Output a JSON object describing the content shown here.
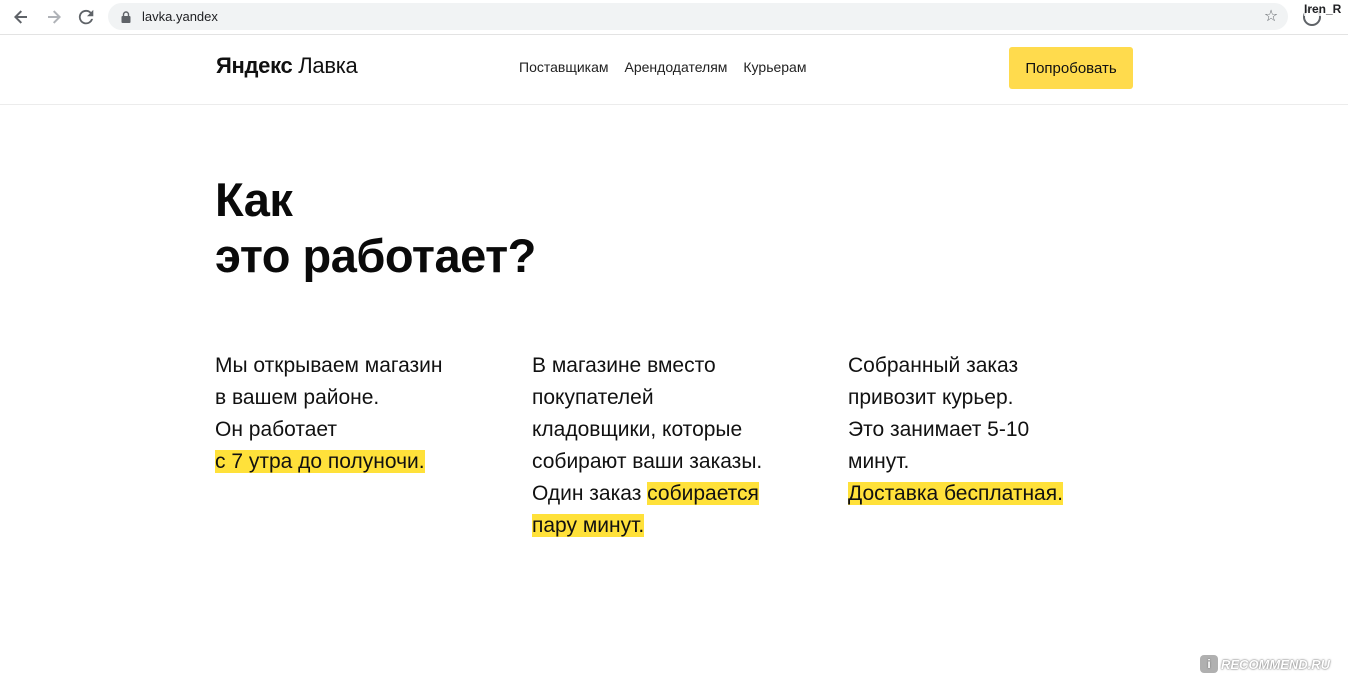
{
  "browser": {
    "url": "lavka.yandex",
    "profile_name": "Iren_R"
  },
  "header": {
    "logo_brand": "Яндекс",
    "logo_product": "Лавка",
    "nav": [
      "Поставщикам",
      "Арендодателям",
      "Курьерам"
    ],
    "cta_label": "Попробовать",
    "cta_color": "#ffdb4d"
  },
  "hero": {
    "title_line1": "Как",
    "title_line2": "это работает?"
  },
  "steps": [
    {
      "lines": [
        "Мы открываем магазин",
        "в вашем районе.",
        "Он работает"
      ],
      "highlight": "с 7 утра до полуночи."
    },
    {
      "lines": [
        "В магазине вместо",
        "покупателей",
        "кладовщики, которые",
        "собирают ваши заказы."
      ],
      "line5_plain": "Один заказ ",
      "line5_highlight": "собирается",
      "line6_highlight": "пару минут."
    },
    {
      "lines": [
        "Собранный заказ",
        "привозит курьер.",
        "Это занимает 5-10",
        "минут."
      ],
      "highlight": "Доставка бесплатная."
    }
  ],
  "highlight_color": "#ffe13a",
  "watermark": {
    "icon_glyph": "i",
    "text": "RECOMMEND.RU"
  }
}
